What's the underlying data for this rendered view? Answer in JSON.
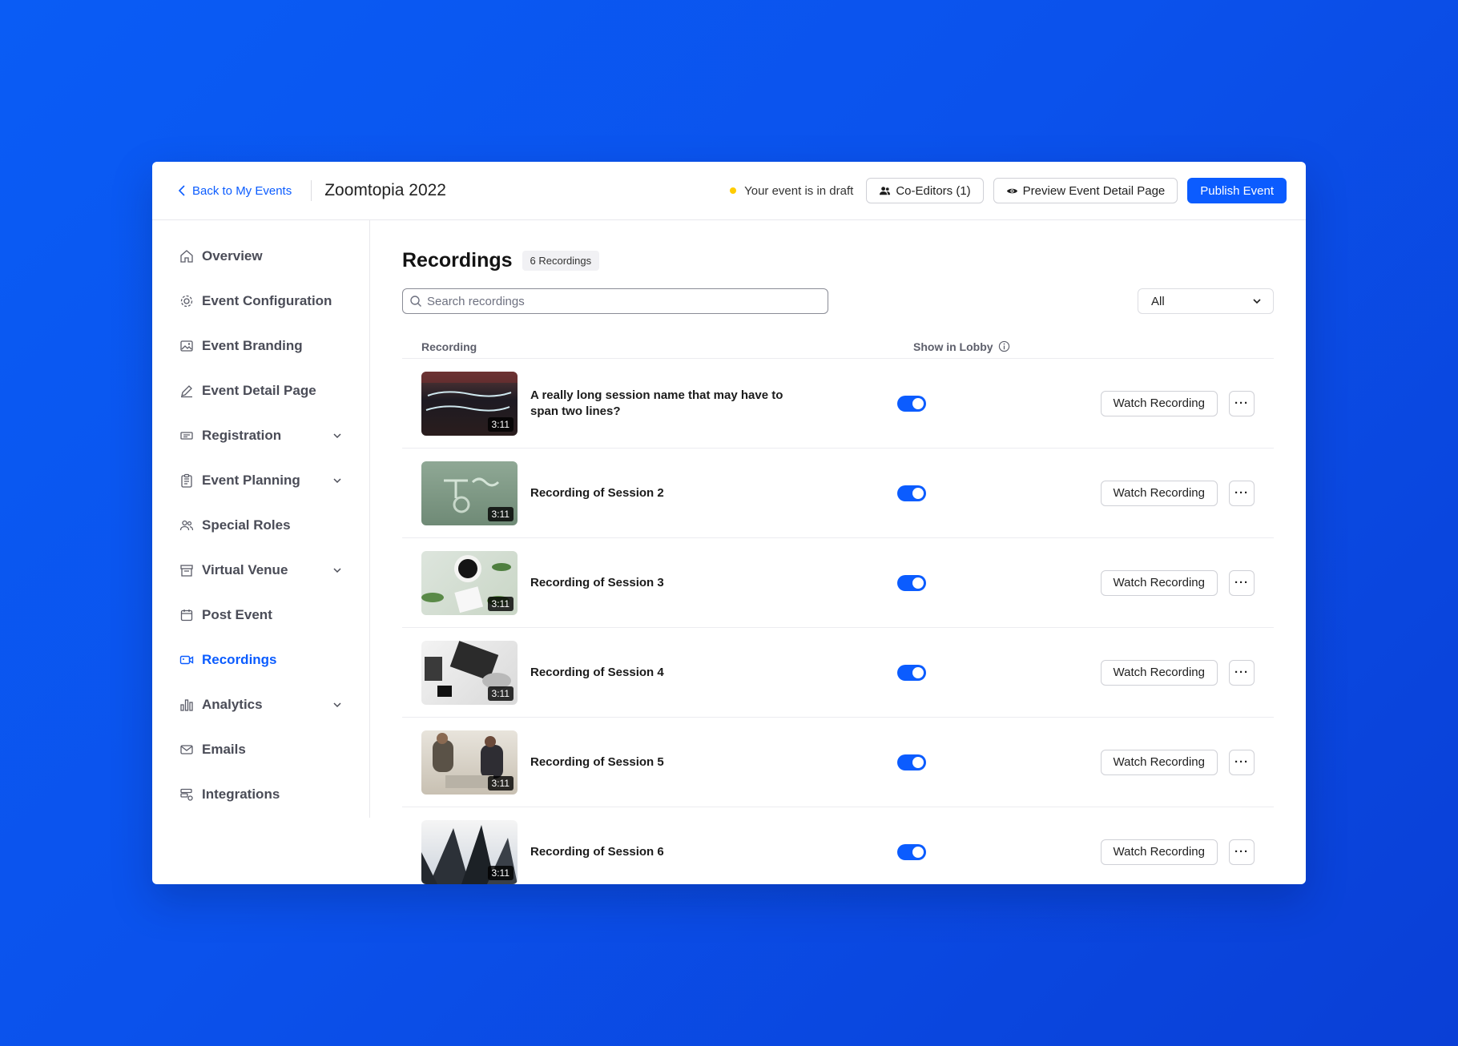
{
  "topbar": {
    "back_label": "Back to My Events",
    "event_title": "Zoomtopia 2022",
    "draft_status": "Your event is in draft",
    "status_color": "#ffcc00",
    "co_editors_label": "Co-Editors (1)",
    "preview_label": "Preview Event Detail Page",
    "publish_label": "Publish Event"
  },
  "sidebar": {
    "items": [
      {
        "label": "Overview",
        "icon": "home-icon",
        "expandable": false,
        "active": false
      },
      {
        "label": "Event Configuration",
        "icon": "gear-icon",
        "expandable": false,
        "active": false
      },
      {
        "label": "Event Branding",
        "icon": "image-icon",
        "expandable": false,
        "active": false
      },
      {
        "label": "Event Detail Page",
        "icon": "pencil-icon",
        "expandable": false,
        "active": false
      },
      {
        "label": "Registration",
        "icon": "ticket-icon",
        "expandable": true,
        "active": false
      },
      {
        "label": "Event Planning",
        "icon": "clipboard-icon",
        "expandable": true,
        "active": false
      },
      {
        "label": "Special Roles",
        "icon": "people-icon",
        "expandable": false,
        "active": false
      },
      {
        "label": "Virtual Venue",
        "icon": "venue-icon",
        "expandable": true,
        "active": false
      },
      {
        "label": "Post Event",
        "icon": "calendar-icon",
        "expandable": false,
        "active": false
      },
      {
        "label": "Recordings",
        "icon": "video-icon",
        "expandable": false,
        "active": true
      },
      {
        "label": "Analytics",
        "icon": "bar-chart-icon",
        "expandable": true,
        "active": false
      },
      {
        "label": "Emails",
        "icon": "mail-icon",
        "expandable": false,
        "active": false
      },
      {
        "label": "Integrations",
        "icon": "integrations-icon",
        "expandable": false,
        "active": false
      }
    ]
  },
  "main": {
    "title": "Recordings",
    "count_label": "6 Recordings",
    "search_placeholder": "Search recordings",
    "filter_value": "All",
    "columns": {
      "recording": "Recording",
      "show_in_lobby": "Show in Lobby"
    },
    "watch_label": "Watch Recording",
    "more_label": "···",
    "accent_color": "#0b5cff",
    "recordings": [
      {
        "title": "A really long session name that may have to span two lines?",
        "duration": "3:11",
        "show_in_lobby": true
      },
      {
        "title": "Recording of Session 2",
        "duration": "3:11",
        "show_in_lobby": true
      },
      {
        "title": "Recording of Session 3",
        "duration": "3:11",
        "show_in_lobby": true
      },
      {
        "title": "Recording of Session 4",
        "duration": "3:11",
        "show_in_lobby": true
      },
      {
        "title": "Recording of Session 5",
        "duration": "3:11",
        "show_in_lobby": true
      },
      {
        "title": "Recording of Session 6",
        "duration": "3:11",
        "show_in_lobby": true
      }
    ]
  }
}
